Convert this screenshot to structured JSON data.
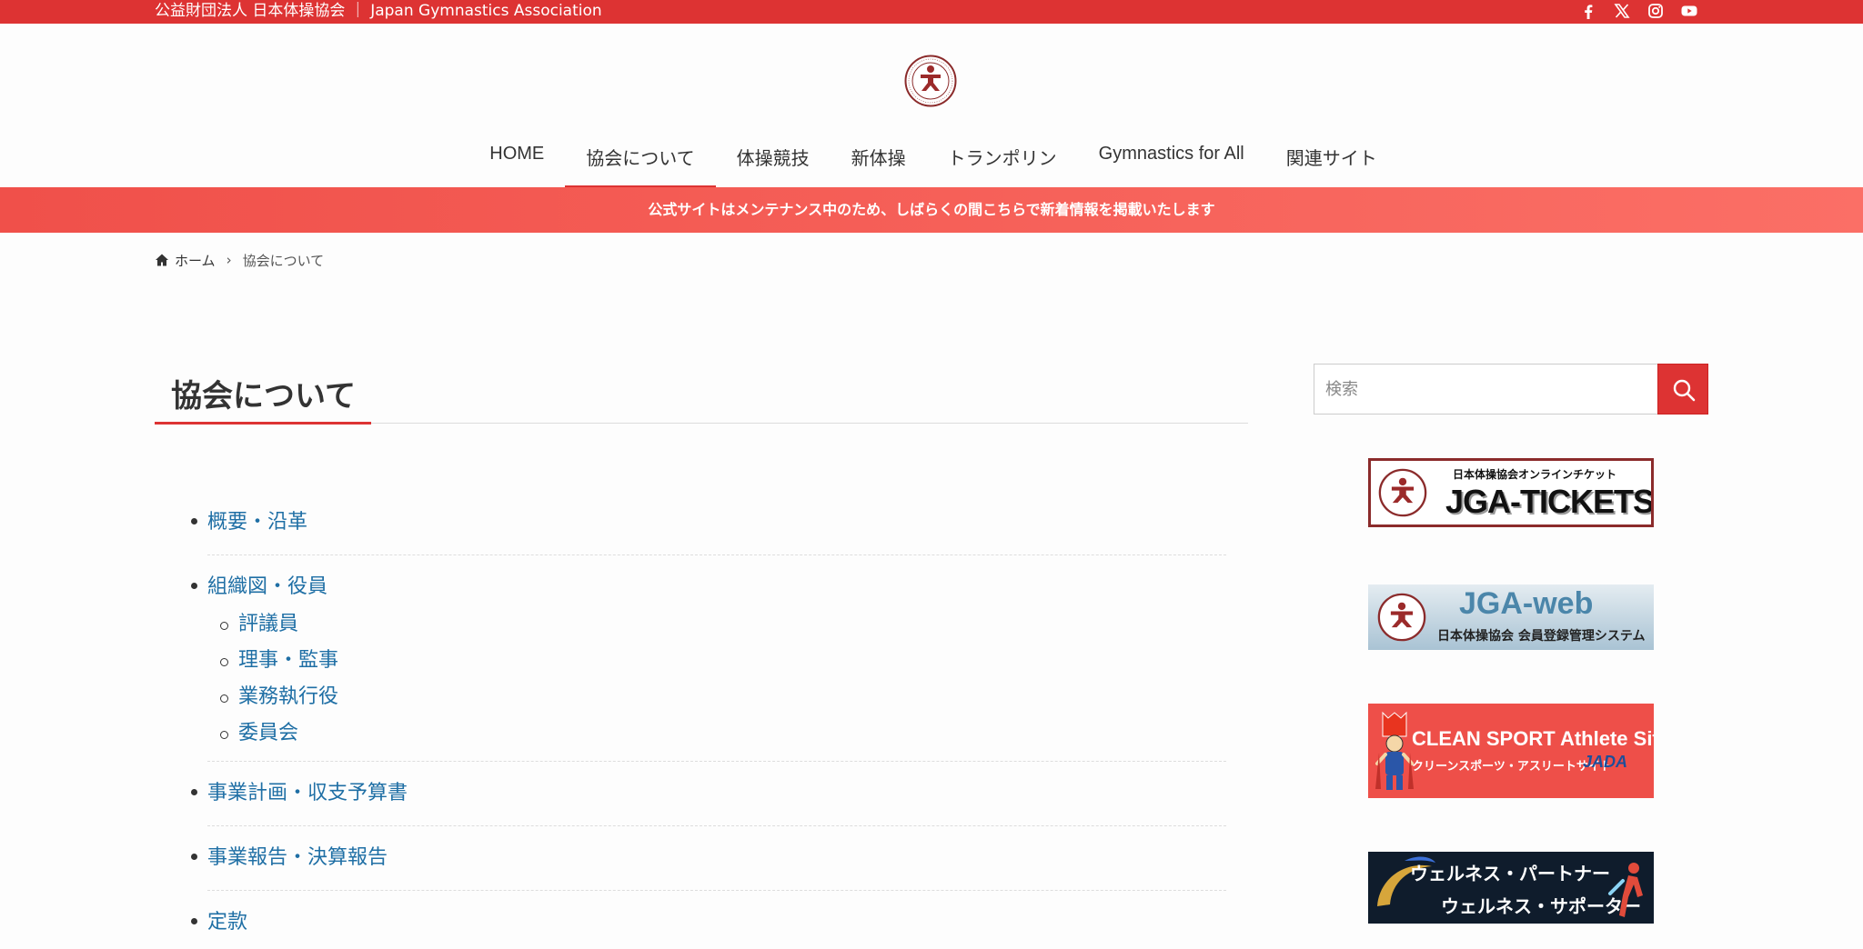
{
  "topbar": {
    "org_name": "公益財団法人 日本体操協会 ｜ Japan Gymnastics Association",
    "social_icons": [
      "facebook-icon",
      "x-icon",
      "instagram-icon",
      "youtube-icon"
    ]
  },
  "nav": {
    "items": [
      {
        "label": "HOME"
      },
      {
        "label": "協会について"
      },
      {
        "label": "体操競技"
      },
      {
        "label": "新体操"
      },
      {
        "label": "トランポリン"
      },
      {
        "label": "Gymnastics for All"
      },
      {
        "label": "関連サイト"
      }
    ],
    "active_index": 1
  },
  "notice": {
    "text": "公式サイトはメンテナンス中のため、しばらくの間こちらで新着情報を掲載いたします"
  },
  "breadcrumb": {
    "home": "ホーム",
    "current": "協会について"
  },
  "page": {
    "title": "協会について"
  },
  "content": {
    "items": [
      {
        "label": "概要・沿革"
      },
      {
        "label": "組織図・役員",
        "children": [
          "評議員",
          "理事・監事",
          "業務執行役",
          "委員会"
        ]
      },
      {
        "label": "事業計画・収支予算書"
      },
      {
        "label": "事業報告・決算報告"
      },
      {
        "label": "定款"
      }
    ]
  },
  "search": {
    "placeholder": "検索"
  },
  "banners": {
    "tickets": {
      "small": "日本体操協会オンラインチケット",
      "big": "JGA-TICKETS"
    },
    "web": {
      "big": "JGA-web",
      "small": "日本体操協会 会員登録管理システム"
    },
    "clean_sport": {
      "big": "CLEAN SPORT Athlete Site",
      "small": "クリーンスポーツ・アスリートサイト",
      "brand": "JADA"
    },
    "wellness": {
      "line1": "ウェルネス・パートナー",
      "line2": "ウェルネス・サポーター"
    }
  },
  "colors": {
    "brand_red": "#dd3333",
    "link_blue": "#1f6fa5"
  }
}
